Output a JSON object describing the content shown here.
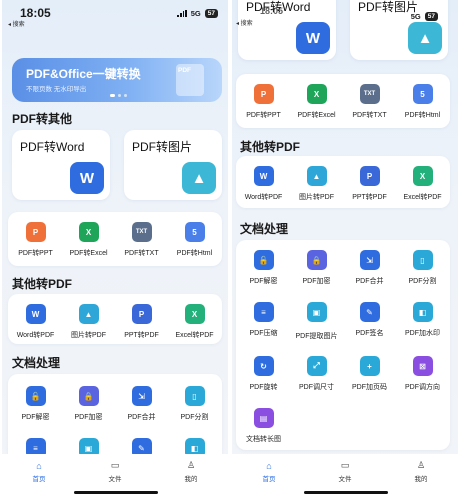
{
  "status": {
    "time": "18:05",
    "back_label": "◂ 搜索",
    "network": "5G",
    "battery": "57"
  },
  "banner": {
    "title": "PDF&Office一键转换",
    "subtitle": "不限页数 无水印导出",
    "pdf_label": "PDF"
  },
  "sections": {
    "pdf_to_other": "PDF转其他",
    "other_to_pdf": "其他转PDF",
    "doc_tools": "文档处理"
  },
  "big_cards": [
    {
      "label": "PDF转Word",
      "icon": "word-icon",
      "glyph": "W",
      "color": "#2f6ce0"
    },
    {
      "label": "PDF转图片",
      "icon": "image-icon",
      "glyph": "▲",
      "color": "#3cb8d6"
    }
  ],
  "convert_tools": [
    {
      "label": "PDF转PPT",
      "icon": "ppt-icon",
      "glyph": "P",
      "color": "#f0703a"
    },
    {
      "label": "PDF转Excel",
      "icon": "excel-icon",
      "glyph": "X",
      "color": "#1fa55a"
    },
    {
      "label": "PDF转TXT",
      "icon": "txt-icon",
      "glyph": "TXT",
      "color": "#5b6f8c"
    },
    {
      "label": "PDF转Html",
      "icon": "html-icon",
      "glyph": "5",
      "color": "#4a7ee8"
    }
  ],
  "other_tools": [
    {
      "label": "Word转PDF",
      "icon": "word-to-pdf-icon",
      "glyph": "W",
      "color": "#2f6ce0"
    },
    {
      "label": "图片转PDF",
      "icon": "image-to-pdf-icon",
      "glyph": "▲",
      "color": "#2ea7d8"
    },
    {
      "label": "PPT转PDF",
      "icon": "ppt-to-pdf-icon",
      "glyph": "P",
      "color": "#3a68d8"
    },
    {
      "label": "Excel转PDF",
      "icon": "excel-to-pdf-icon",
      "glyph": "X",
      "color": "#24b07a"
    }
  ],
  "doc_tools": [
    {
      "label": "PDF解密",
      "icon": "unlock-icon",
      "glyph": "🔓",
      "color": "#2f6ce0"
    },
    {
      "label": "PDF加密",
      "icon": "lock-icon",
      "glyph": "🔒",
      "color": "#5a63e0"
    },
    {
      "label": "PDF合并",
      "icon": "merge-icon",
      "glyph": "⇲",
      "color": "#2f6ce0"
    },
    {
      "label": "PDF分割",
      "icon": "split-icon",
      "glyph": "▯",
      "color": "#2aa9d8"
    },
    {
      "label": "PDF压缩",
      "icon": "compress-icon",
      "glyph": "≡",
      "color": "#2f6ce0"
    },
    {
      "label": "PDF提取图片",
      "icon": "extract-image-icon",
      "glyph": "▣",
      "color": "#2aa9d8"
    },
    {
      "label": "PDF签名",
      "icon": "sign-icon",
      "glyph": "✎",
      "color": "#2f6ce0"
    },
    {
      "label": "PDF加水印",
      "icon": "watermark-icon",
      "glyph": "◧",
      "color": "#2aa9d8"
    },
    {
      "label": "PDF旋转",
      "icon": "rotate-icon",
      "glyph": "↻",
      "color": "#2f6ce0"
    },
    {
      "label": "PDF调尺寸",
      "icon": "resize-icon",
      "glyph": "⤢",
      "color": "#2aa9d8"
    },
    {
      "label": "PDF加页码",
      "icon": "page-number-icon",
      "glyph": "+",
      "color": "#2aa9d8"
    },
    {
      "label": "PDF调方向",
      "icon": "orientation-icon",
      "glyph": "⊠",
      "color": "#8a4fe0"
    },
    {
      "label": "文档转长图",
      "icon": "long-image-icon",
      "glyph": "▤",
      "color": "#8a4fe0"
    }
  ],
  "tabs": [
    {
      "label": "首页",
      "icon": "home-icon",
      "glyph": "⌂"
    },
    {
      "label": "文件",
      "icon": "folder-icon",
      "glyph": "▭"
    },
    {
      "label": "我的",
      "icon": "user-icon",
      "glyph": "♙"
    }
  ]
}
